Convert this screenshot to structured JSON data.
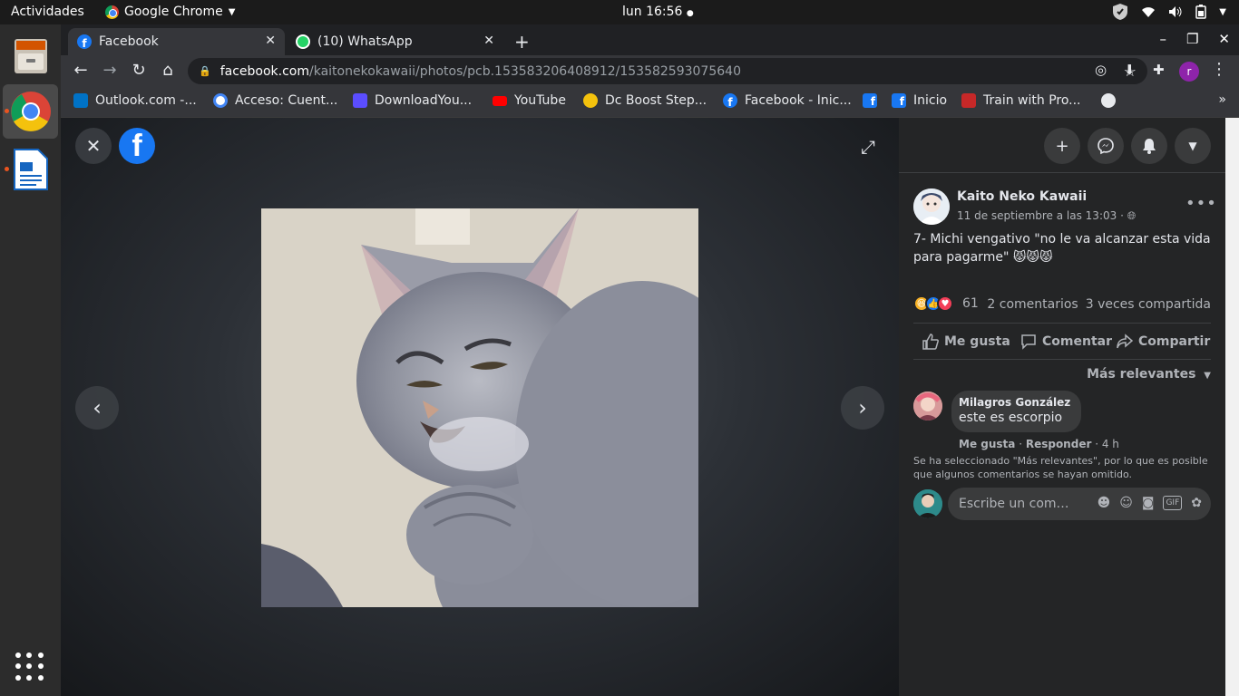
{
  "system": {
    "activities": "Actividades",
    "app_name": "Google Chrome",
    "clock": "lun 16:56"
  },
  "tabs": [
    {
      "title": "Facebook",
      "active": true
    },
    {
      "title": "(10) WhatsApp",
      "active": false
    }
  ],
  "address": {
    "host": "facebook.com",
    "path": "/kaitonekokawaii/photos/pcb.153583206408912/153582593075640"
  },
  "profile_initial": "r",
  "bookmarks": [
    {
      "label": "Outlook.com -...",
      "color": "#0072c6"
    },
    {
      "label": "Acceso: Cuent...",
      "color": "#ffffff"
    },
    {
      "label": "DownloadYou...",
      "color": "#5b4dff"
    },
    {
      "label": "YouTube",
      "color": "#ff0000"
    },
    {
      "label": "Dc Boost Step...",
      "color": "#f4c20d"
    },
    {
      "label": "Facebook - Inic...",
      "color": "#1877f2"
    },
    {
      "label": "",
      "color": "#1877f2"
    },
    {
      "label": "Inicio",
      "color": "#1877f2"
    },
    {
      "label": "Train with Pro...",
      "color": "#c62828"
    },
    {
      "label": "",
      "color": "#e8eaed"
    }
  ],
  "post": {
    "author": "Kaito Neko Kawaii",
    "date": "11 de septiembre a las 13:03 · ",
    "text": "7- Michi vengativo \"no le va alcanzar esta vida para pagarme\" 😾😾😾",
    "reaction_count": "61",
    "comments": "2 comentarios",
    "shares": "3 veces compartida",
    "actions": {
      "like": "Me gusta",
      "comment": "Comentar",
      "share": "Compartir"
    },
    "sort_label": "Más relevantes"
  },
  "comment": {
    "name": "Milagros González",
    "text": "este es escorpio",
    "like": "Me gusta",
    "reply": "Responder",
    "time": "4 h"
  },
  "notice": "Se ha seleccionado \"Más relevantes\", por lo que es posible que algunos comentarios se hayan omitido.",
  "comment_input": {
    "placeholder": "Escribe un com…"
  }
}
